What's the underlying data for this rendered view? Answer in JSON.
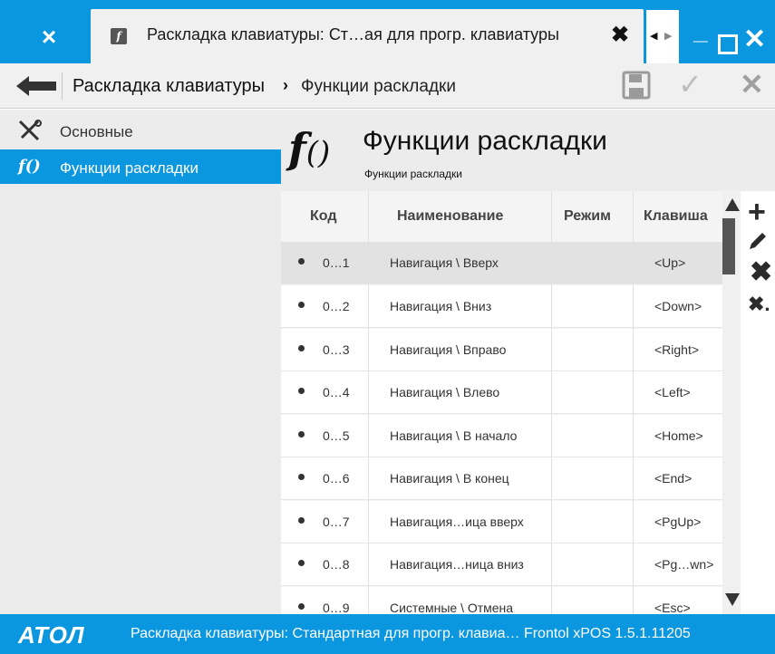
{
  "tabs": {
    "close_left": "×",
    "active_title": "Раскладка клавиатуры: Ст…ая для прогр. клавиатуры",
    "active_close": "✖"
  },
  "window_controls": {
    "minimize": "_",
    "close": "✕"
  },
  "navbar": {
    "breadcrumb_root": "Раскладка клавиатуры",
    "breadcrumb_sep": "›",
    "breadcrumb_current": "Функции раскладки",
    "ok_icon": "✓",
    "cancel_icon": "✕"
  },
  "sidebar": {
    "items": [
      {
        "label": "Основные",
        "icon": "tools-icon",
        "selected": false
      },
      {
        "label": "Функции раскладки",
        "icon": "function-icon",
        "selected": true
      }
    ]
  },
  "header": {
    "icon_text": "f",
    "icon_paren": "()",
    "title": "Функции раскладки",
    "subtitle": "Функции раскладки"
  },
  "grid": {
    "columns": [
      "Код",
      "Наименование",
      "Режим",
      "Клавиша"
    ],
    "rows": [
      {
        "code": "0…1",
        "name": "Навигация \\ Вверх",
        "mode": "",
        "key": "<Up>",
        "selected": true
      },
      {
        "code": "0…2",
        "name": "Навигация \\ Вниз",
        "mode": "",
        "key": "<Down>"
      },
      {
        "code": "0…3",
        "name": "Навигация \\ Вправо",
        "mode": "",
        "key": "<Right>"
      },
      {
        "code": "0…4",
        "name": "Навигация \\ Влево",
        "mode": "",
        "key": "<Left>"
      },
      {
        "code": "0…5",
        "name": "Навигация \\ В начало",
        "mode": "",
        "key": "<Home>"
      },
      {
        "code": "0…6",
        "name": "Навигация \\ В конец",
        "mode": "",
        "key": "<End>"
      },
      {
        "code": "0…7",
        "name": "Навигация…ица вверх",
        "mode": "",
        "key": "<PgUp>"
      },
      {
        "code": "0…8",
        "name": "Навигация…ница вниз",
        "mode": "",
        "key": "<Pg…wn>"
      },
      {
        "code": "0…9",
        "name": "Системные \\ Отмена",
        "mode": "",
        "key": "<Esc>"
      }
    ]
  },
  "actions": {
    "add": "+",
    "delete": "✖",
    "delete_all": "✖."
  },
  "statusbar": {
    "logo": "АТОЛ",
    "text": "Раскладка клавиатуры: Стандартная для прогр. клавиа…   Frontol xPOS 1.5.1.11205"
  },
  "colors": {
    "accent": "#0a97e0",
    "panel": "#ececec",
    "selected_row": "#e2e2e2"
  }
}
